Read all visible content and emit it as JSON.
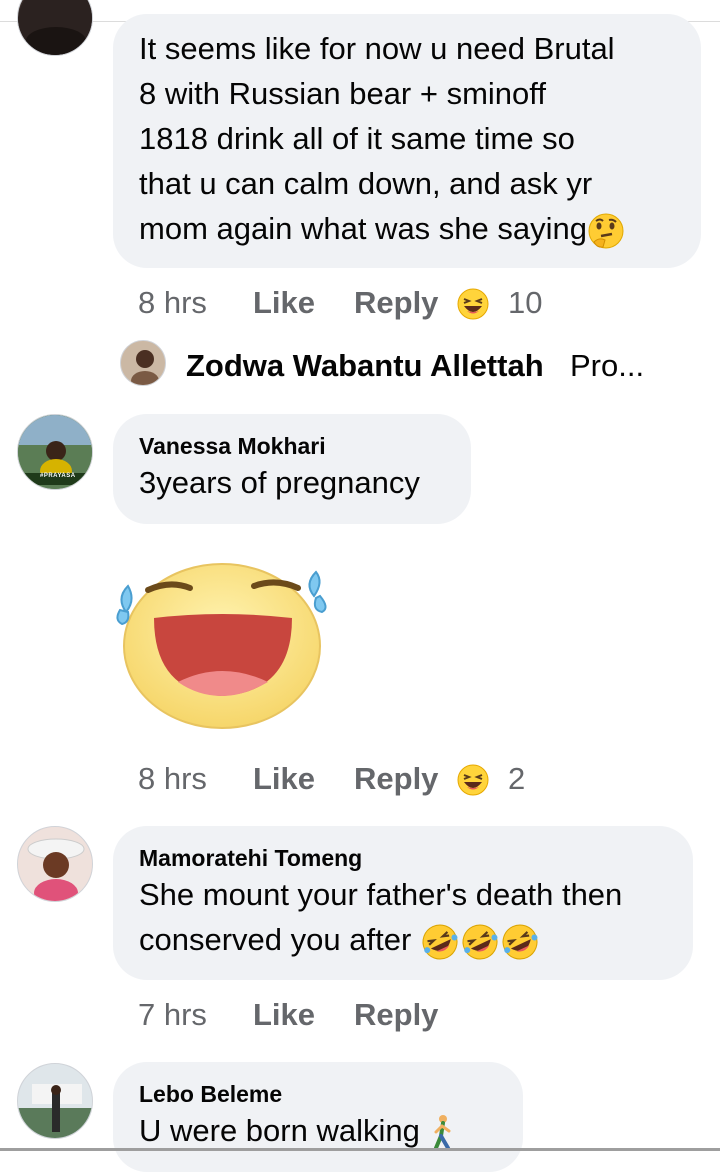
{
  "comments": [
    {
      "name": "",
      "text_lines": [
        "It seems like for now u need Brutal",
        "8 with Russian bear +  sminoff",
        "1818 drink all of it same time so",
        "that u can calm down,  and ask yr",
        "mom again what was she saying"
      ],
      "time": "8 hrs",
      "like": "Like",
      "reply": "Reply",
      "reaction_count": "10",
      "reply_preview": {
        "name": "Zodwa Wabantu Allettah",
        "text": "Pro..."
      }
    },
    {
      "name": "Vanessa Mokhari",
      "text_lines": [
        "3years of pregnancy"
      ],
      "time": "8 hrs",
      "like": "Like",
      "reply": "Reply",
      "reaction_count": "2",
      "avatar_caption": "#PRAYASA"
    },
    {
      "name": "Mamoratehi Tomeng",
      "text_lines": [
        "She mount your father's death then",
        "conserved you after"
      ],
      "time": "7 hrs",
      "like": "Like",
      "reply": "Reply"
    },
    {
      "name": "Lebo Beleme",
      "text_lines": [
        "U were born walking"
      ]
    }
  ],
  "icons": {
    "thinking": "thinking-face-icon",
    "laugh_reaction": "laughing-reaction-icon",
    "rofl": "rolling-laughing-icon",
    "walking": "person-walking-icon",
    "sticker": "laughing-tears-sticker"
  },
  "colors": {
    "bubble": "#f0f2f5",
    "meta": "#65676b",
    "text": "#050505",
    "emoji_yellow": "#ffd43b"
  }
}
